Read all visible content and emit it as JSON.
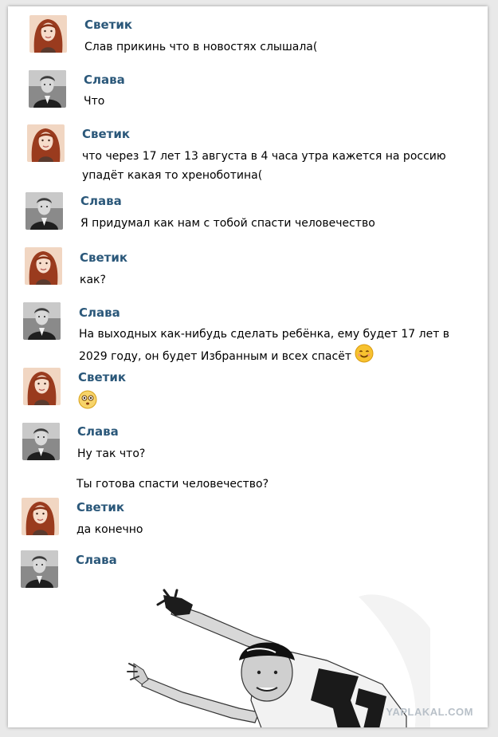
{
  "names": {
    "svetik": "Светик",
    "slava": "Слава"
  },
  "messages": [
    {
      "sender": "Светик",
      "lines": [
        "Слав прикинь что в новостях слышала("
      ]
    },
    {
      "sender": "Слава",
      "lines": [
        "Что"
      ]
    },
    {
      "sender": "Светик",
      "lines": [
        "что через 17 лет 13 августа в 4 часа утра кажется на россию",
        "упадёт какая то хреноботина("
      ]
    },
    {
      "sender": "Слава",
      "lines": [
        "Я придумал как нам с тобой спасти человечество"
      ]
    },
    {
      "sender": "Светик",
      "lines": [
        "как?"
      ]
    },
    {
      "sender": "Слава",
      "lines": [
        "На выходных как-нибудь сделать ребёнка, ему будет 17 лет в",
        "2029 году, он будет Избранным и всех спасёт"
      ],
      "emoji": "smile-emoji"
    },
    {
      "sender": "Светик",
      "lines": [],
      "emoji": "shocked-emoji"
    },
    {
      "sender": "Слава",
      "lines": [
        "Ну так что?"
      ]
    },
    {
      "sender": "",
      "lines": [
        "Ты готова спасти человечество?"
      ]
    },
    {
      "sender": "Светик",
      "lines": [
        "да конечно"
      ]
    },
    {
      "sender": "Слава",
      "lines": []
    }
  ],
  "watermark": "YAPLAKAL.COM",
  "colors": {
    "name": "#2b587a",
    "text": "#000000",
    "background": "#ffffff",
    "page": "#e9e9e9"
  }
}
